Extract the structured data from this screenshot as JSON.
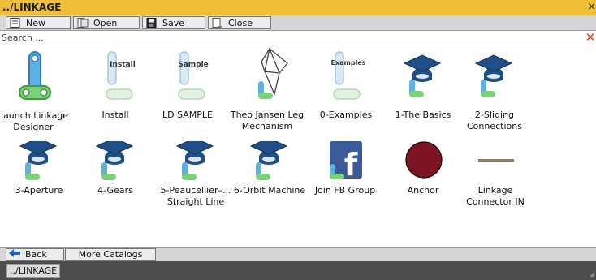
{
  "window": {
    "title": "../LINKAGE",
    "close_glyph": "×"
  },
  "toolbar": {
    "new_label": "New",
    "open_label": "Open",
    "save_label": "Save",
    "close_label": "Close"
  },
  "search": {
    "placeholder": "Search ...",
    "clear_glyph": "✕"
  },
  "catalog": {
    "items": [
      {
        "label": "Launch Linkage Designer",
        "icon": "linkage-launch-icon"
      },
      {
        "label": "Install",
        "icon": "install-icon",
        "badge": "Install"
      },
      {
        "label": "LD SAMPLE",
        "icon": "sample-icon",
        "badge": "Sample"
      },
      {
        "label": "Theo Jansen Leg Mechanism",
        "icon": "leg-mechanism-icon"
      },
      {
        "label": "0-Examples",
        "icon": "examples-icon",
        "badge": "Examples"
      },
      {
        "label": "1-The Basics",
        "icon": "graduation-cap-icon"
      },
      {
        "label": "2-Sliding Connections",
        "icon": "graduation-cap-icon"
      },
      {
        "label": "3-Aperture",
        "icon": "graduation-cap-icon"
      },
      {
        "label": "4-Gears",
        "icon": "graduation-cap-icon"
      },
      {
        "label": "5-Peaucellier–... Straight Line",
        "icon": "graduation-cap-icon"
      },
      {
        "label": "6-Orbit Machine",
        "icon": "graduation-cap-icon"
      },
      {
        "label": "Join FB Group",
        "icon": "facebook-icon",
        "badge": "f"
      },
      {
        "label": "Anchor",
        "icon": "anchor-icon"
      },
      {
        "label": "Linkage Connector IN",
        "icon": "connector-line-icon"
      }
    ]
  },
  "bottom": {
    "back_label": "Back",
    "more_label": "More Catalogs"
  },
  "status": {
    "tab_label": "../LINKAGE",
    "grip_glyph": "◢"
  },
  "colors": {
    "title_bar": "#f0bf3a",
    "cap": "#1f4f86",
    "anchor": "#7d1424",
    "facebook": "#3b5a99",
    "linkage_green": "#6cc26a",
    "linkage_blue": "#2c7db3"
  }
}
